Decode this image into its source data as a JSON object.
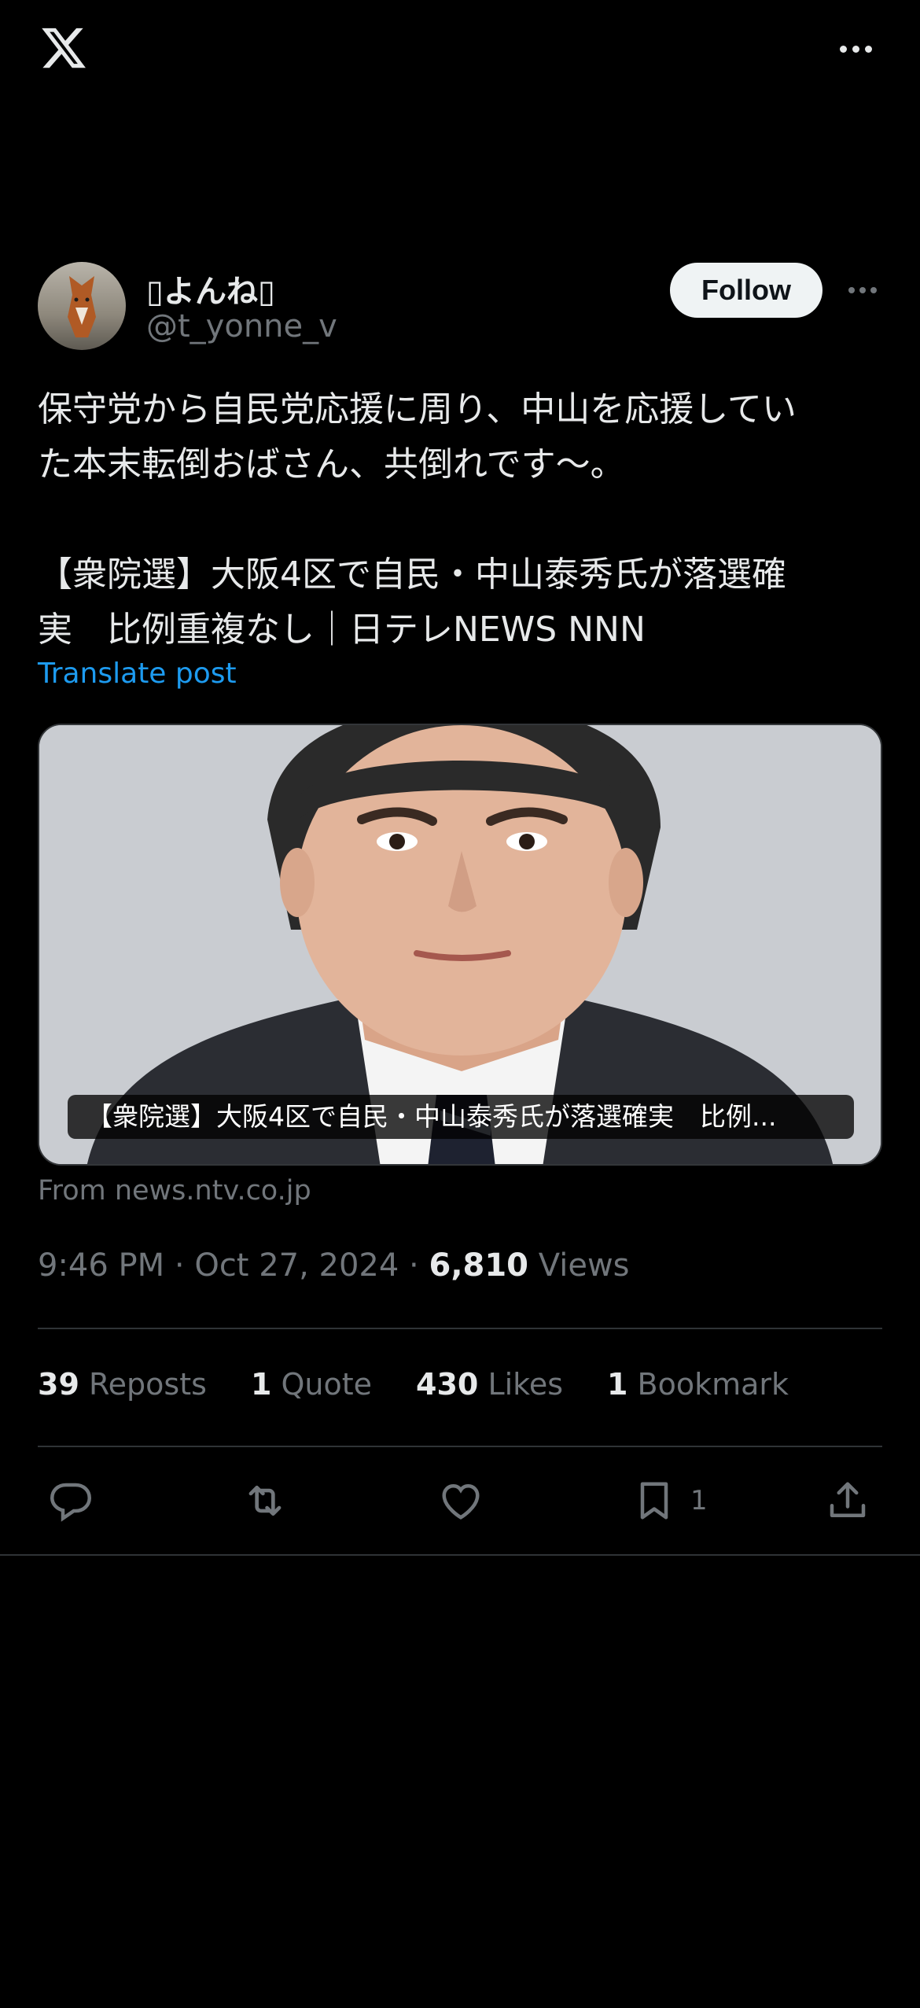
{
  "header": {
    "display_name": "▯よんね▯",
    "handle": "@t_yonne_v",
    "follow_label": "Follow"
  },
  "post": {
    "lines": [
      "保守党から自民党応援に周り、中山を応援してい",
      "た本末転倒おばさん、共倒れです〜。",
      "【衆院選】大阪4区で自民・中山泰秀氏が落選確",
      "実　比例重複なし｜日テレNEWS NNN"
    ],
    "translate_label": "Translate post"
  },
  "card": {
    "caption": "【衆院選】大阪4区で自民・中山泰秀氏が落選確実　比例...",
    "source": "From news.ntv.co.jp"
  },
  "meta": {
    "time": "9:46 PM",
    "date": "Oct 27, 2024",
    "views_count": "6,810",
    "views_label": "Views",
    "separator": "·"
  },
  "stats": {
    "reposts_count": "39",
    "reposts_label": "Reposts",
    "quotes_count": "1",
    "quotes_label": "Quote",
    "likes_count": "430",
    "likes_label": "Likes",
    "bookmarks_count": "1",
    "bookmarks_label": "Bookmark"
  },
  "actions": {
    "reply_icon": "reply-icon",
    "repost_icon": "repost-icon",
    "like_icon": "heart-icon",
    "bookmark_icon": "bookmark-icon",
    "bookmark_count": "1",
    "share_icon": "share-icon"
  },
  "colors": {
    "background": "#000000",
    "text_primary": "#e7e9ea",
    "text_secondary": "#71767b",
    "link": "#1d9bf0",
    "follow_bg": "#eff3f4",
    "divider": "#2f3336"
  }
}
